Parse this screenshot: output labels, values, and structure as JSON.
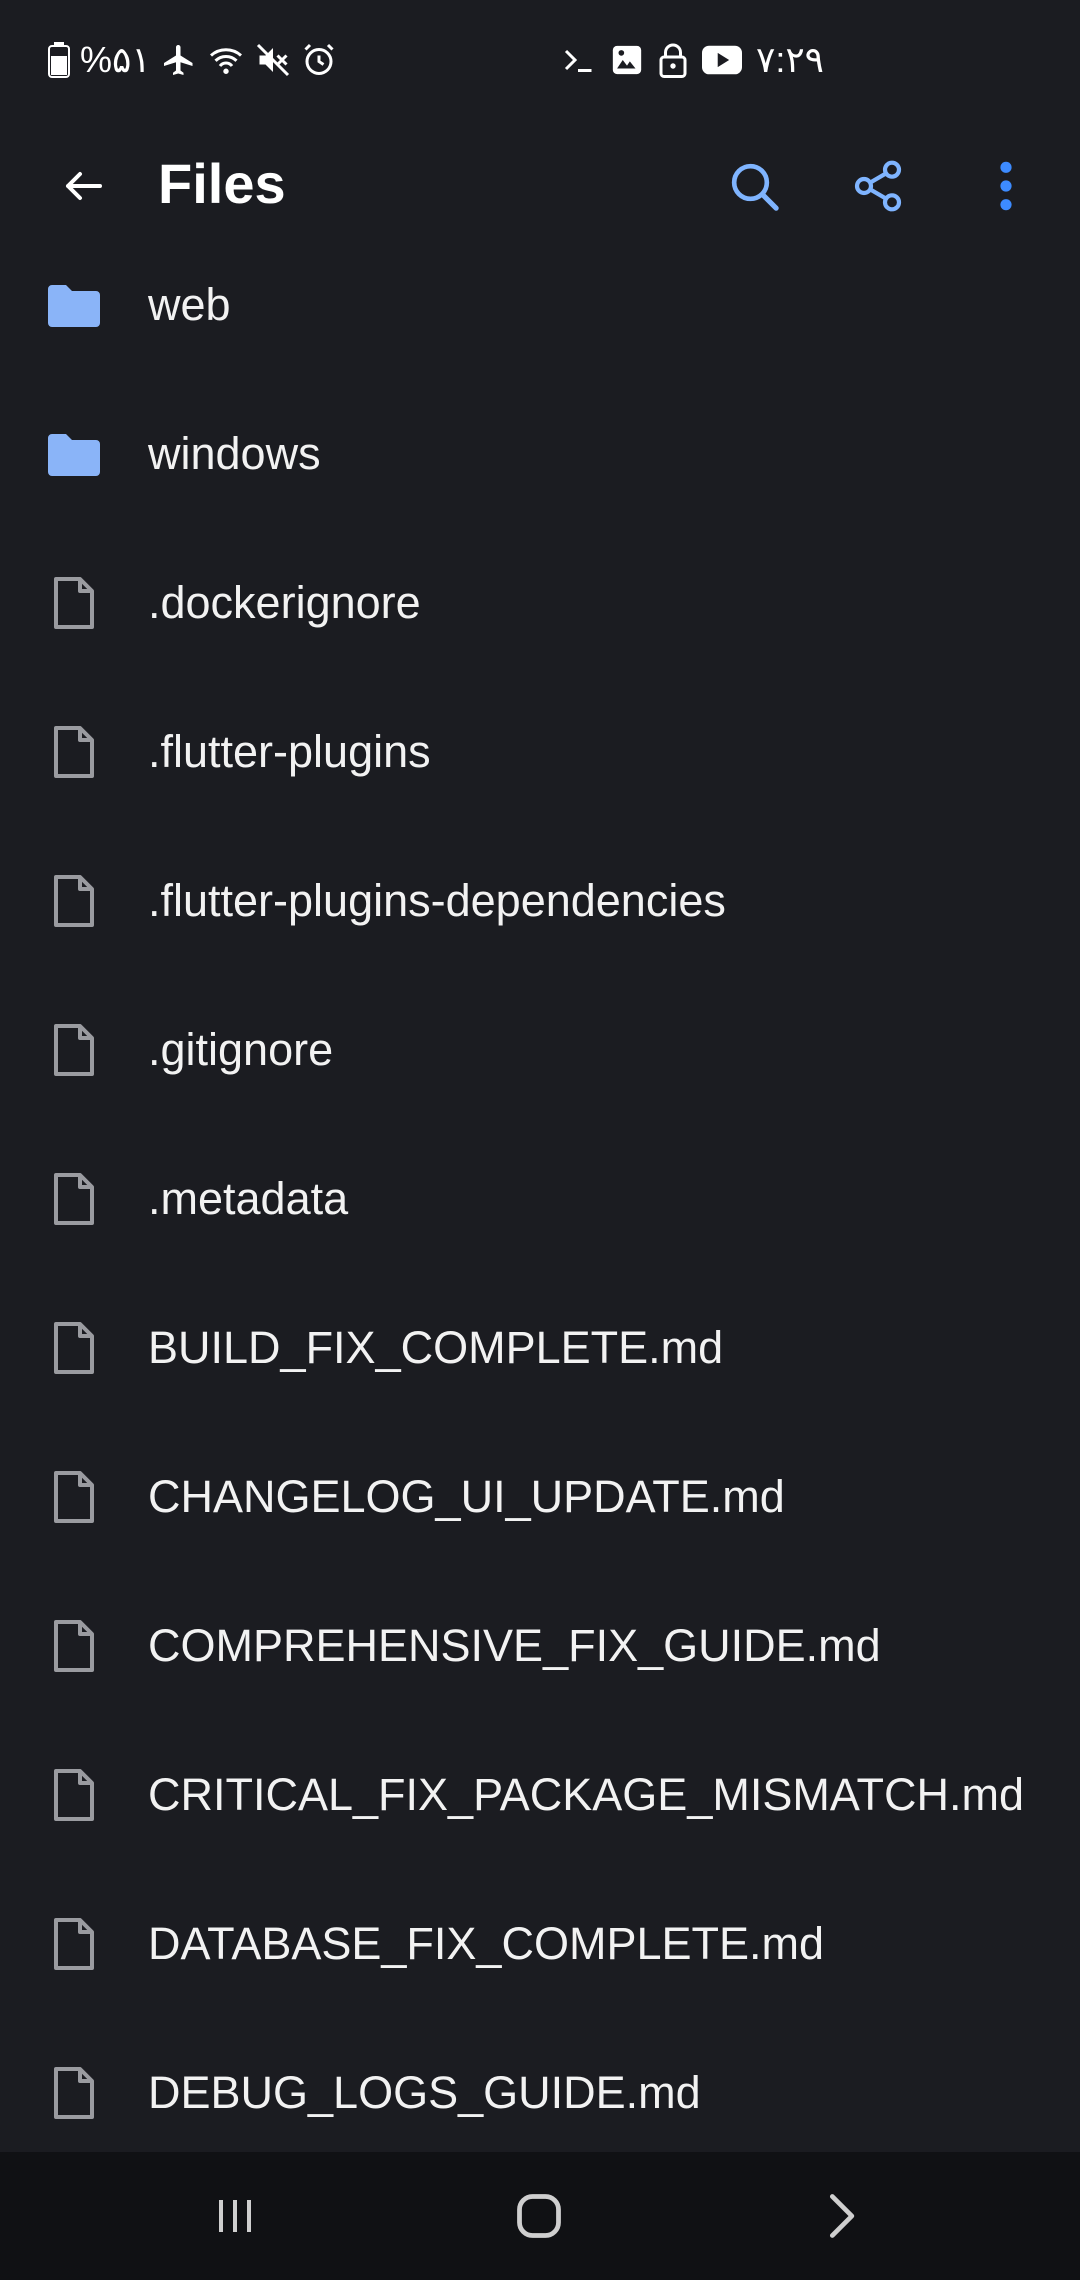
{
  "status_bar": {
    "battery_text": "%۵۱",
    "time": "۷:۲۹",
    "left_icons": [
      "battery-icon",
      "airplane-icon",
      "wifi-icon",
      "mute-icon",
      "alarm-icon"
    ],
    "center_icons": [
      "terminal-icon",
      "image-icon",
      "lock-icon",
      "youtube-icon"
    ]
  },
  "app_bar": {
    "title": "Files",
    "accent_color": "#7fb4ff",
    "actions": [
      "search-icon",
      "share-icon",
      "more-vert-icon"
    ]
  },
  "files": [
    {
      "name": "web",
      "type": "folder"
    },
    {
      "name": "windows",
      "type": "folder"
    },
    {
      "name": ".dockerignore",
      "type": "file"
    },
    {
      "name": ".flutter-plugins",
      "type": "file"
    },
    {
      "name": ".flutter-plugins-dependencies",
      "type": "file"
    },
    {
      "name": ".gitignore",
      "type": "file"
    },
    {
      "name": ".metadata",
      "type": "file"
    },
    {
      "name": "BUILD_FIX_COMPLETE.md",
      "type": "file"
    },
    {
      "name": "CHANGELOG_UI_UPDATE.md",
      "type": "file"
    },
    {
      "name": "COMPREHENSIVE_FIX_GUIDE.md",
      "type": "file"
    },
    {
      "name": "CRITICAL_FIX_PACKAGE_MISMATCH.md",
      "type": "file"
    },
    {
      "name": "DATABASE_FIX_COMPLETE.md",
      "type": "file"
    },
    {
      "name": "DEBUG_LOGS_GUIDE.md",
      "type": "file"
    }
  ],
  "nav_bar": {
    "buttons": [
      "recents-icon",
      "home-icon",
      "back-chevron-icon"
    ]
  },
  "colors": {
    "background": "#1b1c21",
    "folder": "#8ab4f8",
    "file_icon": "#9a9ba0",
    "nav_background": "#101114"
  }
}
